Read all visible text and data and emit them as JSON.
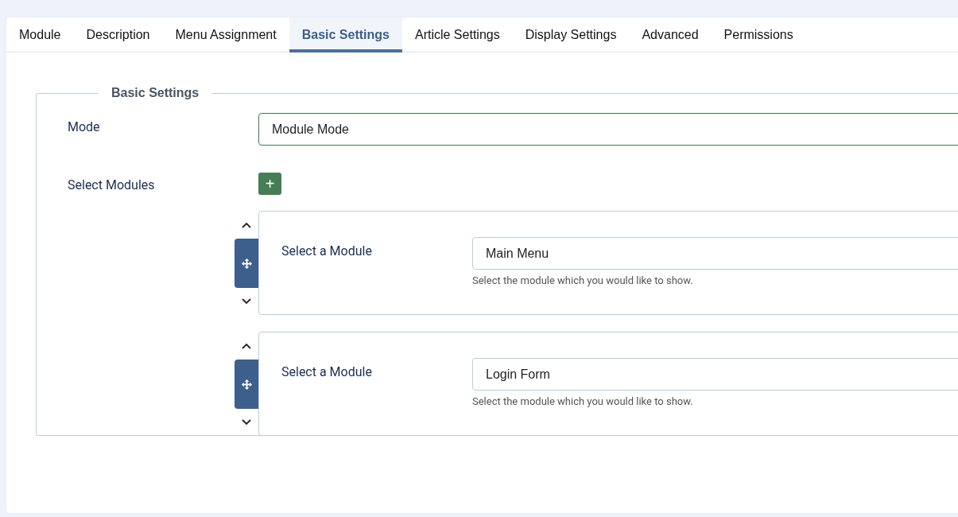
{
  "tabs": [
    {
      "label": "Module",
      "selected": false
    },
    {
      "label": "Description",
      "selected": false
    },
    {
      "label": "Menu Assignment",
      "selected": false
    },
    {
      "label": "Basic Settings",
      "selected": true
    },
    {
      "label": "Article Settings",
      "selected": false
    },
    {
      "label": "Display Settings",
      "selected": false
    },
    {
      "label": "Advanced",
      "selected": false
    },
    {
      "label": "Permissions",
      "selected": false
    }
  ],
  "fieldset": {
    "legend": "Basic Settings",
    "mode": {
      "label": "Mode",
      "value": "Module Mode"
    },
    "select_modules": {
      "label": "Select Modules",
      "add_button": "+",
      "rows": [
        {
          "label": "Select a Module",
          "value": "Main Menu",
          "help": "Select the module which you would like to show."
        },
        {
          "label": "Select a Module",
          "value": "Login Form",
          "help": "Select the module which you would like to show."
        }
      ]
    }
  }
}
